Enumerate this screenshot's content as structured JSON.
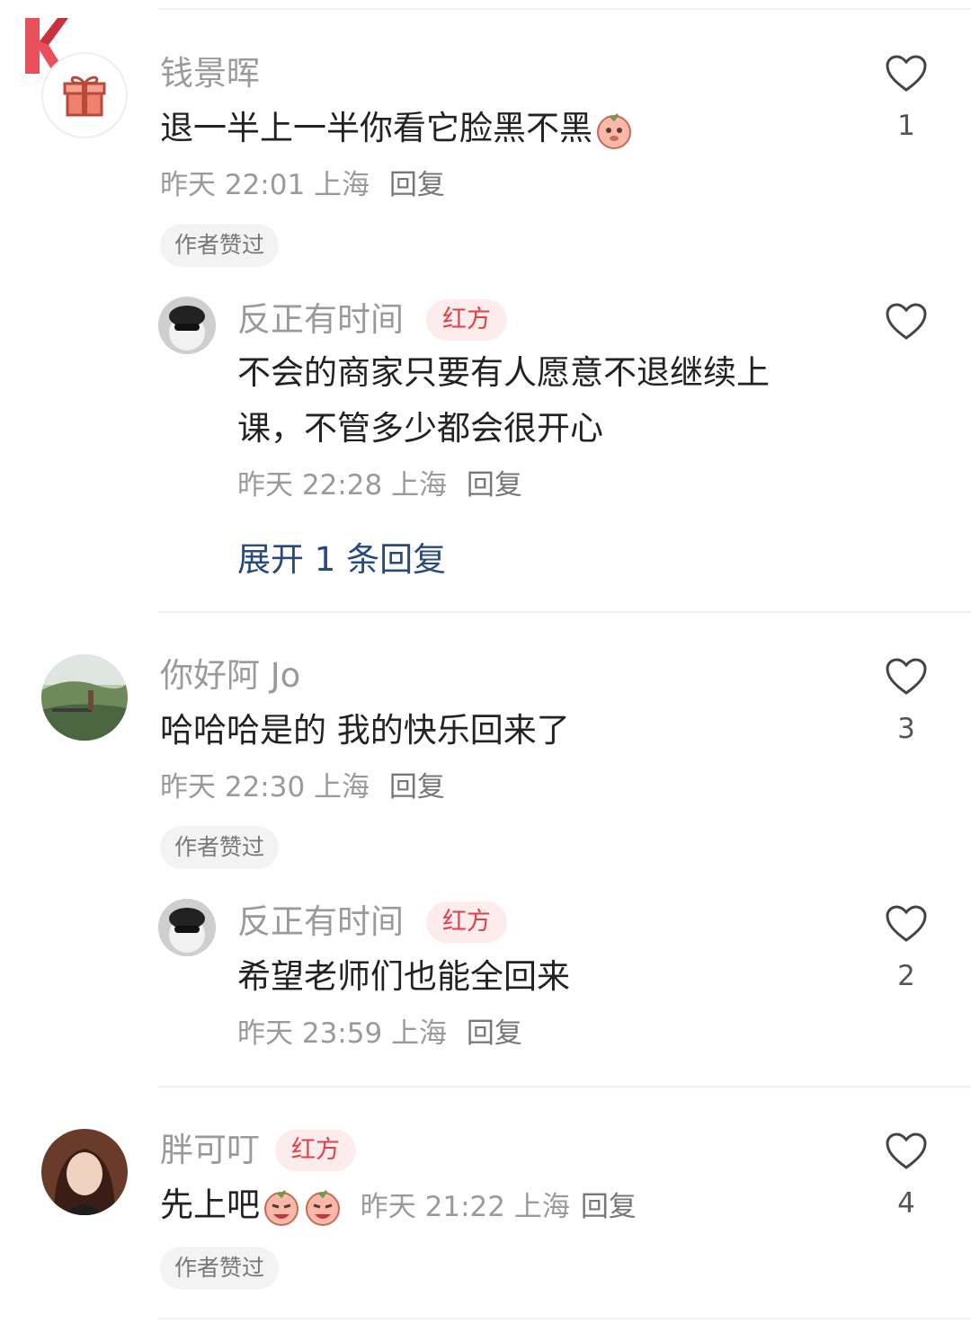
{
  "comments": [
    {
      "name": "钱景晖",
      "text": "退一半上一半你看它脸黑不黑",
      "time": "昨天 22:01",
      "location": "上海",
      "reply_label": "回复",
      "liked_by_author": "作者赞过",
      "likes": "1",
      "avatar_icon": "gift-icon",
      "replies": [
        {
          "name": "反正有时间",
          "badge": "红方",
          "text_line1": "不会的商家只要有人愿意不退继续上",
          "text_line2": "课，不管多少都会很开心",
          "time": "昨天 22:28",
          "location": "上海",
          "reply_label": "回复",
          "likes": ""
        }
      ],
      "expand_label": "展开 1 条回复"
    },
    {
      "name": "你好阿 Jo",
      "text": "哈哈哈是的 我的快乐回来了",
      "time": "昨天 22:30",
      "location": "上海",
      "reply_label": "回复",
      "liked_by_author": "作者赞过",
      "likes": "3",
      "replies": [
        {
          "name": "反正有时间",
          "badge": "红方",
          "text": "希望老师们也能全回来",
          "time": "昨天 23:59",
          "location": "上海",
          "reply_label": "回复",
          "likes": "2"
        }
      ]
    },
    {
      "name": "胖可叮",
      "badge": "红方",
      "text": "先上吧",
      "time": "昨天 21:22",
      "location": "上海",
      "reply_label": "回复",
      "liked_by_author": "作者赞过",
      "likes": "4"
    }
  ],
  "colors": {
    "badge_text": "#e0404a",
    "expand_link": "#2a4a7a",
    "logo": "#e8505b"
  }
}
